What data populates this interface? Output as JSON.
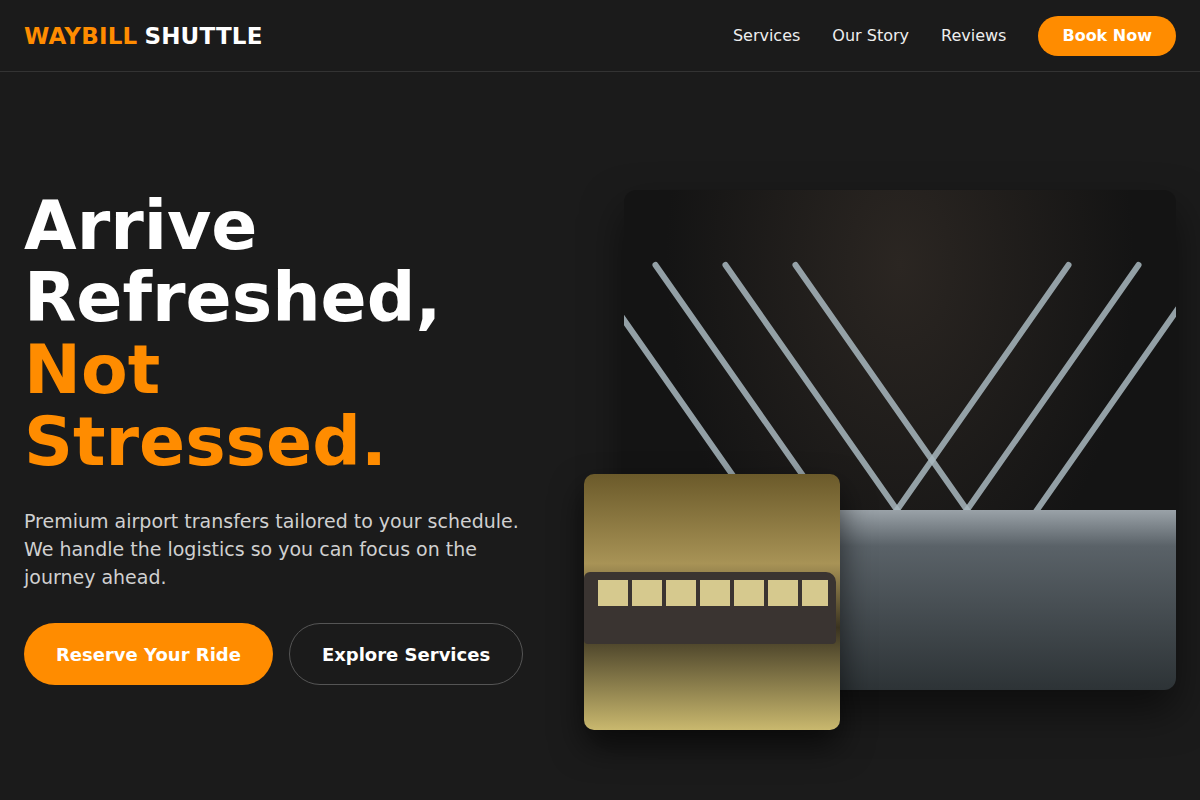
{
  "header": {
    "logo": {
      "accent": "WAYBILL",
      "rest": "SHUTTLE"
    },
    "nav": [
      {
        "label": "Services"
      },
      {
        "label": "Our Story"
      },
      {
        "label": "Reviews"
      }
    ],
    "cta": "Book Now"
  },
  "hero": {
    "title_lines": [
      "Arrive",
      "Refreshed,"
    ],
    "accent_lines": [
      "Not",
      "Stressed."
    ],
    "subtitle": "Premium airport transfers tailored to your schedule. We handle the logistics so you can focus on the journey ahead.",
    "buttons": [
      {
        "label": "Reserve Your Ride",
        "kind": "primary"
      },
      {
        "label": "Explore Services",
        "kind": "secondary"
      }
    ]
  }
}
